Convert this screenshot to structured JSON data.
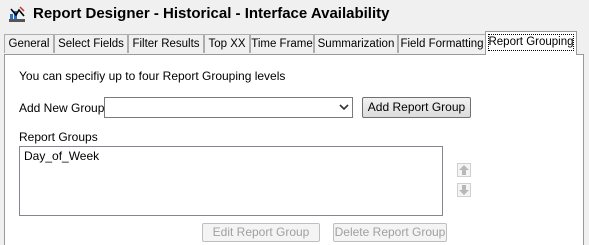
{
  "window": {
    "title": "Report Designer - Historical - Interface Availability"
  },
  "tabs": [
    {
      "label": "General"
    },
    {
      "label": "Select Fields"
    },
    {
      "label": "Filter Results"
    },
    {
      "label": "Top XX"
    },
    {
      "label": "Time Frame"
    },
    {
      "label": "Summarization"
    },
    {
      "label": "Field Formatting"
    },
    {
      "label": "Report Grouping",
      "active": true
    }
  ],
  "grouping": {
    "info_text": "You can specifiy up to four Report Grouping levels",
    "add_new_group_label": "Add New Group",
    "add_new_group_value": "",
    "add_button_label": "Add Report Group",
    "report_groups_label": "Report Groups",
    "report_groups": [
      "Day_of_Week"
    ],
    "edit_button_label": "Edit Report Group",
    "delete_button_label": "Delete Report Group"
  },
  "icons": {
    "app": "report-designer-icon",
    "move_up": "move-up-arrow-icon",
    "move_down": "move-down-arrow-icon",
    "dropdown": "chevron-down-icon"
  }
}
